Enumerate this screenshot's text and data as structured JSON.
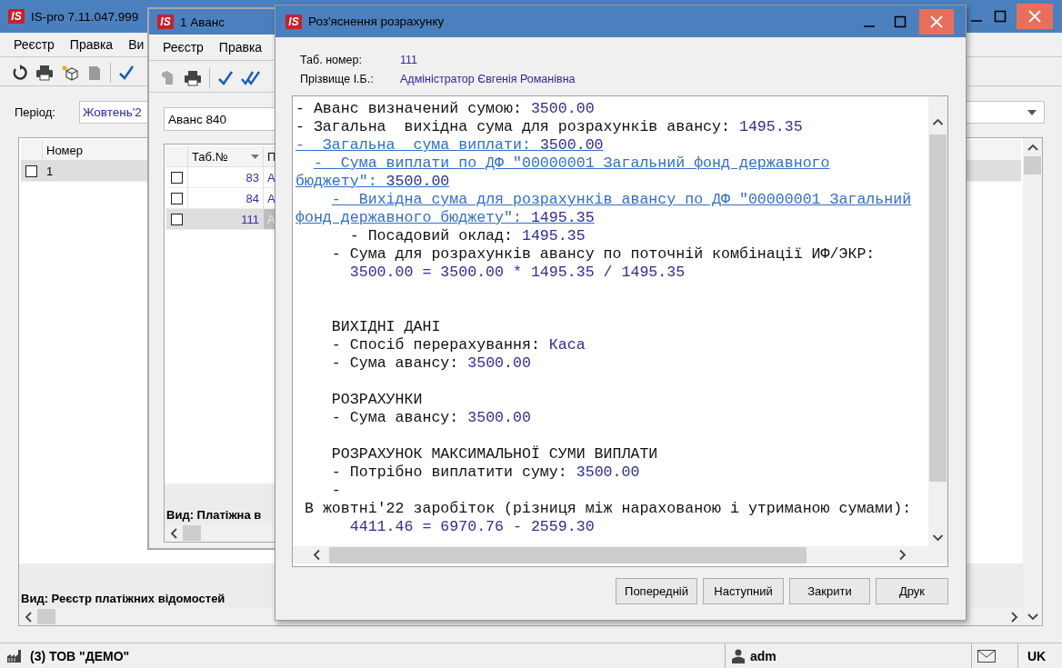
{
  "main_window": {
    "logo": "IS",
    "title": "IS-pro 7.11.047.999",
    "menu": [
      "Реєстр",
      "Правка",
      "Ви"
    ],
    "period": {
      "label": "Період:",
      "value": "Жовтень'2"
    },
    "table": {
      "columns": [
        "Номер"
      ],
      "rows": [
        {
          "cells": [
            "1"
          ],
          "checked": false,
          "selected": true
        }
      ]
    },
    "view_label": "Вид: Реєстр платіжних відомостей"
  },
  "advance_window": {
    "logo": "IS",
    "title": "1 Аванс",
    "menu": [
      "Реєстр",
      "Правка"
    ],
    "document": "Аванс 840",
    "table": {
      "columns": [
        "Таб.№",
        "П"
      ],
      "rows": [
        {
          "cells": [
            "83",
            "А"
          ],
          "checked": false,
          "selected": false
        },
        {
          "cells": [
            "84",
            "А"
          ],
          "checked": false,
          "selected": false
        },
        {
          "cells": [
            "111",
            "А"
          ],
          "checked": false,
          "selected": true
        }
      ]
    },
    "view_label": "Вид: Платіжна в"
  },
  "dialog": {
    "logo": "IS",
    "title": "Роз'яснення розрахунку",
    "fields": [
      {
        "label": "Таб. номер:",
        "value": "111"
      },
      {
        "label": "Прізвище І.Б.:",
        "value": "Адміністратор Євгенія Романівна"
      }
    ],
    "lines": [
      {
        "kind": "text",
        "text": "- Аванс визначений сумою: ",
        "value": "3500.00"
      },
      {
        "kind": "text",
        "text": "- Загальна  вихідна сума для розрахунків авансу: ",
        "value": "1495.35"
      },
      {
        "kind": "link",
        "text": "-  Загальна  сума виплати: ",
        "value": "3500.00"
      },
      {
        "kind": "link",
        "text": "  -  Сума виплати по ДФ \"00000001 Загальний фонд державного"
      },
      {
        "kind": "link",
        "text": "бюджету\": ",
        "value": "3500.00"
      },
      {
        "kind": "link",
        "text": "    -  Вихідна сума для розрахунків авансу по ДФ \"00000001 Загальний"
      },
      {
        "kind": "link",
        "text": "фонд державного бюджету\": ",
        "value": "1495.35"
      },
      {
        "kind": "text",
        "text": "      - Посадовий оклад: ",
        "value": "1495.35"
      },
      {
        "kind": "text",
        "text": "    - Сума для розрахунків авансу по поточній комбінації ИФ/ЭКР:"
      },
      {
        "kind": "text",
        "value": "      3500.00 = 3500.00 * 1495.35 / 1495.35"
      },
      {
        "kind": "blank"
      },
      {
        "kind": "blank"
      },
      {
        "kind": "text",
        "text": "    ВИХІДНІ ДАНІ"
      },
      {
        "kind": "text",
        "text": "    - Спосіб перерахування: ",
        "value": "Каса"
      },
      {
        "kind": "text",
        "text": "    - Сума авансу: ",
        "value": "3500.00"
      },
      {
        "kind": "blank"
      },
      {
        "kind": "text",
        "text": "    РОЗРАХУНКИ"
      },
      {
        "kind": "text",
        "text": "    - Сума авансу: ",
        "value": "3500.00"
      },
      {
        "kind": "blank"
      },
      {
        "kind": "text",
        "text": "    РОЗРАХУНОК МАКСИМАЛЬНОЇ СУМИ ВИПЛАТИ"
      },
      {
        "kind": "text",
        "text": "    - Потрібно виплатити суму: ",
        "value": "3500.00"
      },
      {
        "kind": "text",
        "text": "    -"
      },
      {
        "kind": "text",
        "text": " В жовтні'22 заробіток (різниця між нарахованою і утриманою сумами):"
      },
      {
        "kind": "text",
        "value": "      4411.46 = 6970.76 - 2559.30"
      }
    ],
    "buttons": [
      "Попередній",
      "Наступний",
      "Закрити",
      "Друк"
    ]
  },
  "status_bar": {
    "company": "(3) ТОВ \"ДЕМО\"",
    "user": "adm",
    "language": "UK"
  }
}
